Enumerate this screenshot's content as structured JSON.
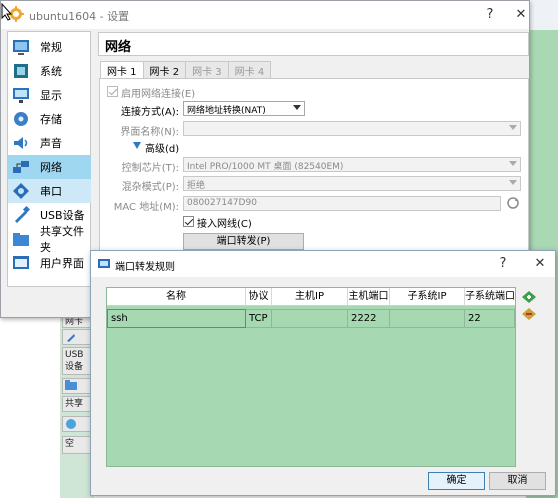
{
  "settings_window": {
    "title": "ubuntu1604 - 设置",
    "help": "?",
    "close": "✕",
    "nav": [
      {
        "label": "常规",
        "icon": "general-icon"
      },
      {
        "label": "系统",
        "icon": "system-icon"
      },
      {
        "label": "显示",
        "icon": "display-icon"
      },
      {
        "label": "存储",
        "icon": "storage-icon"
      },
      {
        "label": "声音",
        "icon": "audio-icon"
      },
      {
        "label": "网络",
        "icon": "network-icon"
      },
      {
        "label": "串口",
        "icon": "serial-port-icon"
      },
      {
        "label": "USB设备",
        "icon": "usb-icon"
      },
      {
        "label": "共享文件夹",
        "icon": "shared-folder-icon"
      },
      {
        "label": "用户界面",
        "icon": "user-interface-icon"
      }
    ],
    "selected_nav": "网络",
    "section_title": "网络",
    "tabs": [
      "网卡 1",
      "网卡 2",
      "网卡 3",
      "网卡 4"
    ],
    "active_tab": "网卡 1",
    "enable_adapter": {
      "label": "启用网络连接(E)",
      "checked": true
    },
    "attached_to": {
      "label": "连接方式(A):",
      "value": "网络地址转换(NAT)"
    },
    "interface_name": {
      "label": "界面名称(N):",
      "value": ""
    },
    "advanced": {
      "label": "高级(d)"
    },
    "adapter_type": {
      "label": "控制芯片(T):",
      "value": "Intel PRO/1000 MT 桌面 (82540EM)"
    },
    "promiscuous": {
      "label": "混杂模式(P):",
      "value": "拒绝"
    },
    "mac": {
      "label": "MAC 地址(M):",
      "value": "080027147D90"
    },
    "cable_connected": {
      "label": "接入网线(C)",
      "checked": true
    },
    "port_forward_button": "端口转发(P)"
  },
  "background": {
    "items": [
      "网卡",
      "USB 设备",
      "共享",
      "空"
    ]
  },
  "port_forward_dialog": {
    "title": "端口转发规则",
    "help": "?",
    "close": "✕",
    "columns": [
      "名称",
      "协议",
      "主机IP",
      "主机端口",
      "子系统IP",
      "子系统端口"
    ],
    "rows": [
      [
        "ssh",
        "TCP",
        "",
        "2222",
        "",
        "22"
      ]
    ],
    "ok": "确定",
    "cancel": "取消",
    "colors": {
      "table_bg": "#a6d9b1"
    }
  }
}
